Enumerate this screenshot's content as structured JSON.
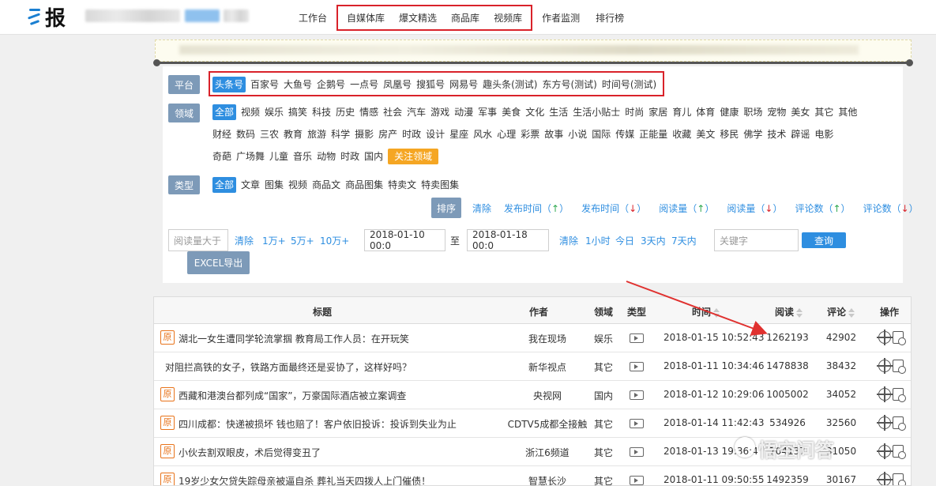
{
  "header": {
    "logo_text": "报",
    "nav": [
      "工作台",
      "自媒体库",
      "爆文精选",
      "商品库",
      "视频库",
      "作者监测",
      "排行榜"
    ]
  },
  "filters": {
    "platform_label": "平台",
    "platforms": [
      "头条号",
      "百家号",
      "大鱼号",
      "企鹅号",
      "一点号",
      "凤凰号",
      "搜狐号",
      "网易号",
      "趣头条(测试)",
      "东方号(测试)",
      "时间号(测试)"
    ],
    "domain_label": "领域",
    "domains_row1": [
      "全部",
      "视频",
      "娱乐",
      "搞笑",
      "科技",
      "历史",
      "情感",
      "社会",
      "汽车",
      "游戏",
      "动漫",
      "军事",
      "美食",
      "文化",
      "生活",
      "生活小贴士",
      "时尚",
      "家居",
      "育儿",
      "体育",
      "健康",
      "职场",
      "宠物",
      "美女",
      "其它",
      "其他"
    ],
    "domains_row2": [
      "财经",
      "数码",
      "三农",
      "教育",
      "旅游",
      "科学",
      "摄影",
      "房产",
      "时政",
      "设计",
      "星座",
      "风水",
      "心理",
      "彩票",
      "故事",
      "小说",
      "国际",
      "传媒",
      "正能量",
      "收藏",
      "美文",
      "移民",
      "佛学",
      "技术",
      "辟谣",
      "电影"
    ],
    "domains_row3": [
      "奇葩",
      "广场舞",
      "儿童",
      "音乐",
      "动物",
      "时政",
      "国内"
    ],
    "follow_domain": "关注领域",
    "type_label": "类型",
    "types": [
      "全部",
      "文章",
      "图集",
      "视频",
      "商品文",
      "商品图集",
      "特卖文",
      "特卖图集"
    ],
    "sort_label": "排序",
    "sort_clear": "清除",
    "sort_options": [
      {
        "text": "发布时间",
        "arrow": "↑"
      },
      {
        "text": "发布时间",
        "arrow": "↓"
      },
      {
        "text": "阅读量",
        "arrow": "↑"
      },
      {
        "text": "阅读量",
        "arrow": "↓"
      },
      {
        "text": "评论数",
        "arrow": "↑"
      },
      {
        "text": "评论数",
        "arrow": "↓"
      }
    ],
    "read_placeholder": "阅读量大于",
    "read_links": [
      "清除",
      "1万+",
      "5万+",
      "10万+"
    ],
    "date_start": "2018-01-10 00:0",
    "date_to": "至",
    "date_end": "2018-01-18 00:0",
    "date_links": [
      "清除",
      "1小时",
      "今日",
      "3天内",
      "7天内"
    ],
    "keyword_placeholder": "关键字",
    "search_btn": "查询",
    "excel_btn": "EXCEL导出"
  },
  "table": {
    "headers": {
      "title": "标题",
      "author": "作者",
      "domain": "领域",
      "type": "类型",
      "time": "时间",
      "reads": "阅读",
      "comments": "评论",
      "ops": "操作"
    },
    "original_badge": "原",
    "rows": [
      {
        "original": true,
        "title": "湖北一女生遭同学轮流掌掴 教育局工作人员：在开玩笑",
        "author": "我在现场",
        "domain": "娱乐",
        "time": "2018-01-15 10:52:43",
        "reads": "1262193",
        "comments": "42902"
      },
      {
        "original": false,
        "title": "对阻拦高铁的女子，铁路方面最终还是妥协了，这样好吗？",
        "author": "新华视点",
        "domain": "其它",
        "time": "2018-01-11 10:34:46",
        "reads": "1478838",
        "comments": "38432"
      },
      {
        "original": true,
        "title": "西藏和港澳台都列成“国家”，万豪国际酒店被立案调查",
        "author": "央视网",
        "domain": "国内",
        "time": "2018-01-12 10:29:06",
        "reads": "1005002",
        "comments": "34052"
      },
      {
        "original": true,
        "title": "四川成都：快递被损坏 钱也赔了！客户依旧投诉：投诉到失业为止",
        "author": "CDTV5成都全接触",
        "domain": "其它",
        "time": "2018-01-14 11:42:43",
        "reads": "534926",
        "comments": "32560"
      },
      {
        "original": true,
        "title": "小伙去割双眼皮，术后觉得变丑了",
        "author": "浙江6频道",
        "domain": "其它",
        "time": "2018-01-13 19:36:4",
        "reads": "704137",
        "comments": "31050"
      },
      {
        "original": true,
        "title": "19岁少女欠贷失踪母亲被逼自杀 葬礼当天四拨人上门催债！",
        "author": "智慧长沙",
        "domain": "其它",
        "time": "2018-01-11 09:50:55",
        "reads": "1492359",
        "comments": "30167"
      }
    ]
  },
  "watermark": "悟空问答",
  "colors": {
    "accent": "#2e8ee0",
    "highlight": "#d9222a",
    "label_bg": "#7d9ab8",
    "orange": "#f5a623"
  }
}
